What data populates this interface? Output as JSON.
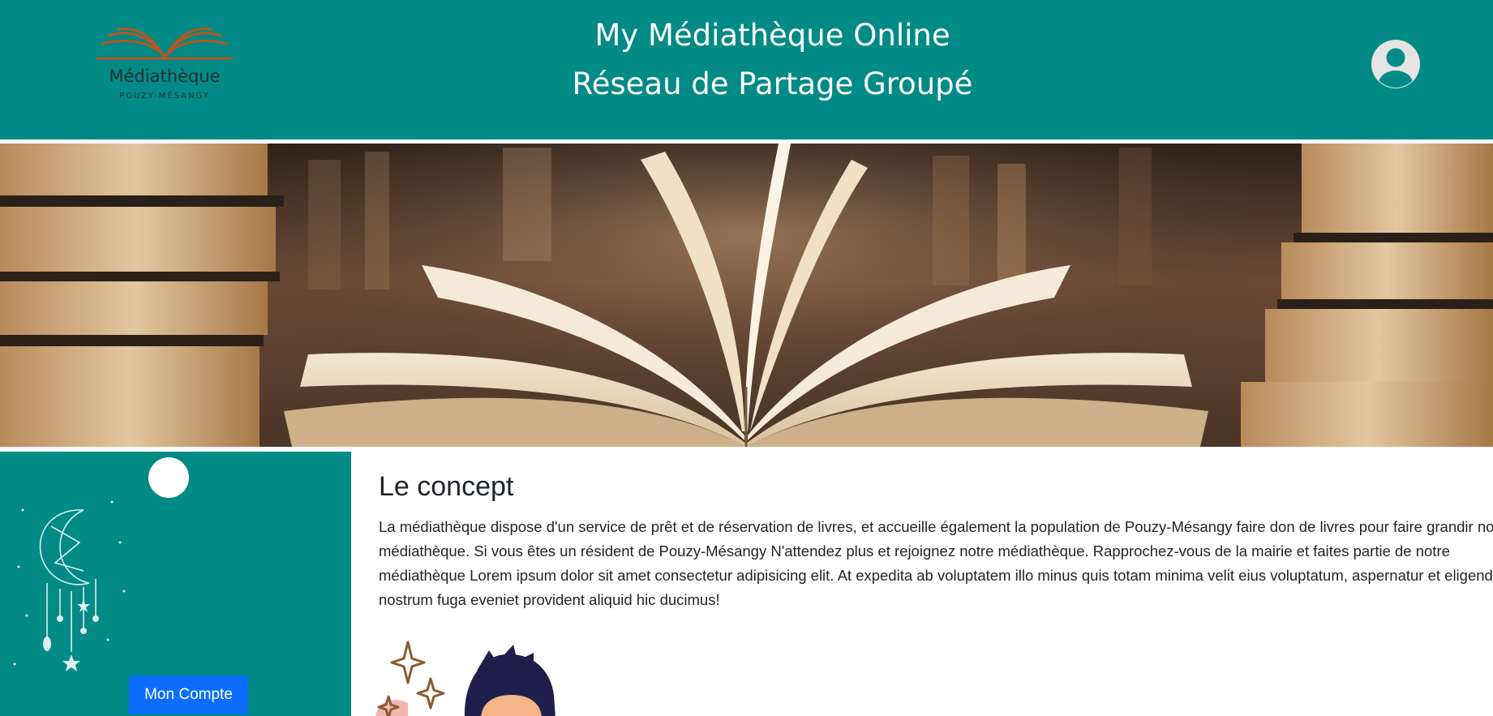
{
  "header": {
    "logo": {
      "name": "Médiathèque",
      "subtitle": "POUZY-MÉSANGY",
      "icon": "open-book-icon",
      "color": "#b5571f"
    },
    "title_line1": "My Médiathèque Online",
    "title_line2": "Réseau de Partage Groupé",
    "user_icon": "user-avatar-icon",
    "background": "#028a86"
  },
  "banner": {
    "image": "open-book-library-photo"
  },
  "sidebar": {
    "background": "#028a86",
    "illustration": "crescent-moon-dreamcatcher-icon",
    "account_button_label": "Mon Compte",
    "button_color": "#0d6efd"
  },
  "main": {
    "section_title": "Le concept",
    "section_text": "La médiathèque dispose d'un service de prêt et de réservation de livres, et accueille également la population de Pouzy-Mésangy faire don de livres pour faire grandir notre médiathèque. Si vous êtes un résident de Pouzy-Mésangy N'attendez plus et rejoignez notre médiathèque. Rapprochez-vous de la mairie et faites partie de notre médiathèque Lorem ipsum dolor sit amet consectetur adipisicing elit. At expedita ab voluptatem illo minus quis totam minima velit eius voluptatum, aspernatur et eligendi nostrum fuga eveniet provident aliquid hic ducimus!",
    "illustration": "reading-person-illustration"
  }
}
